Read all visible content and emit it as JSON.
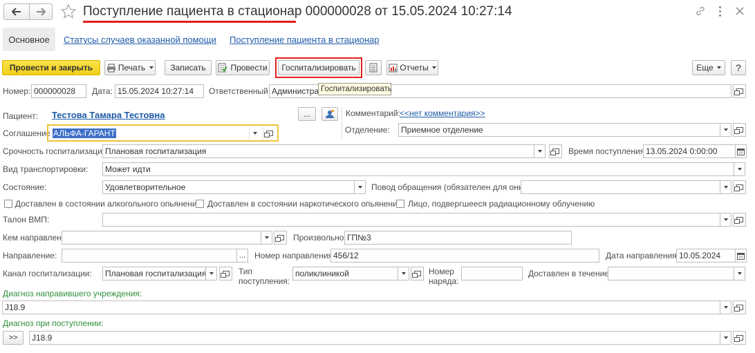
{
  "window": {
    "title_main": "Поступление пациента в стационар",
    "title_rest": " 000000028 от 15.05.2024 10:27:14"
  },
  "tabs": [
    "Основное",
    "Статусы случаев оказанной помощи",
    "Поступление пациента в стационар"
  ],
  "toolbar": {
    "post_close": "Провести и закрыть",
    "print": "Печать",
    "save": "Записать",
    "post": "Провести",
    "hospitalize": "Госпитализировать",
    "reports": "Отчеты",
    "more": "Еще",
    "help": "?",
    "tooltip": "Госпитализировать"
  },
  "header": {
    "number_label": "Номер:",
    "number": "000000028",
    "date_label": "Дата:",
    "date": "15.05.2024 10:27:14",
    "responsible_label": "Ответственный:",
    "responsible": "Администрат"
  },
  "patient": {
    "label": "Пациент:",
    "name": "Тестова Тамара Тестовна",
    "more_btn": "...",
    "agreement_label": "Соглашение:",
    "agreement": "АЛЬФА-ГАРАНТ"
  },
  "comment": {
    "label": "Комментарий:",
    "value": "<<нет комментария>>"
  },
  "department": {
    "label": "Отделение:",
    "value": "Приемное отделение"
  },
  "urgency": {
    "label": "Срочность госпитализации:",
    "value": "Плановая госпитализация"
  },
  "arrival_time": {
    "label": "Время поступления:",
    "value": "13.05.2024  0:00:00"
  },
  "transport": {
    "label": "Вид транспортировки:",
    "value": "Может идти"
  },
  "state": {
    "label": "Состояние:",
    "value": "Удовлетворительное"
  },
  "reason": {
    "label": "Повод обращения (обязателен для онко):",
    "value": ""
  },
  "checkboxes": [
    "Доставлен в состоянии алкогольного опьянения",
    "Доставлен в состоянии наркотического опьянения",
    "Лицо, подвергшееся радиационному облучению"
  ],
  "vmp": {
    "label": "Талон ВМП:",
    "value": ""
  },
  "referred_by": {
    "label": "Кем направлен:",
    "value": ""
  },
  "arbitrary": {
    "label": "Произвольно:",
    "value": "ГП№3"
  },
  "referral": {
    "label": "Направление:",
    "value": "",
    "more": "..."
  },
  "referral_number": {
    "label": "Номер направления:",
    "value": "456/12"
  },
  "referral_date": {
    "label": "Дата направления:",
    "value": "10.05.2024"
  },
  "channel": {
    "label": "Канал госпитализации:",
    "value": "Плановая госпитализация"
  },
  "admission_type": {
    "label_1": "Тип",
    "label_2": "поступления:",
    "value": "поликлиникой"
  },
  "order_number": {
    "label_1": "Номер",
    "label_2": "наряда:",
    "value": ""
  },
  "delivered_within": {
    "label": "Доставлен в течение:",
    "value": ""
  },
  "diag_ref": {
    "label": "Диагноз направившего учреждения:",
    "value": "J18.9"
  },
  "diag_admission": {
    "label": "Диагноз при поступлении:",
    "value": "J18.9",
    "expand": ">>"
  }
}
